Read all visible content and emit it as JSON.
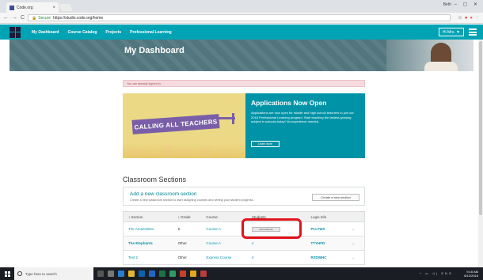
{
  "browser": {
    "tab_title": "Code.org",
    "tab_close": "×",
    "user_label": "Beth",
    "window_controls": "– ▢ ✕",
    "secure_label": "Secure",
    "url": "https://studio.code.org/home",
    "back": "←",
    "forward": "→",
    "reload": "C",
    "star": "☆"
  },
  "nav": {
    "items": [
      "My Dashboard",
      "Course Catalog",
      "Projects",
      "Professional Learning"
    ],
    "user_menu": "Hi Mrs. ▼"
  },
  "header": {
    "title": "My Dashboard"
  },
  "alert": {
    "text": "You are already signed in."
  },
  "promo": {
    "banner_text": "CALLING ALL TEACHERS",
    "heading": "Applications Now Open",
    "body": "Applications are now open for middle and high school teachers to join our 2018 Professional Learning program. Start teaching the fastest-growing subject in schools today! No experience needed.",
    "button": "Learn more"
  },
  "sections": {
    "title": "Classroom Sections",
    "add_heading": "Add a new classroom section",
    "add_desc": "Create a new classroom section to start assigning courses and seeing your student progress.",
    "create_button": "Create a new section",
    "columns": [
      "Section",
      "Grade",
      "Course",
      "Students",
      "Login Info"
    ],
    "rows": [
      {
        "section": "The Amazeletes",
        "grade": "K",
        "course": "Course A",
        "students_btn": "Add students",
        "login": "PLLTWX"
      },
      {
        "section": "The Elephants",
        "grade": "Other",
        "course": "Course A",
        "students": "4",
        "login": "TTYHFD"
      },
      {
        "section": "Test 2",
        "grade": "Other",
        "course": "Express Course",
        "students": "4",
        "login": "RZDWHC"
      }
    ]
  },
  "taskbar": {
    "search_placeholder": "Type here to search",
    "time": "9:16 AM",
    "date": "6/12/2018",
    "tray": "^ ▭ ◁) ENG"
  },
  "colors": {
    "teal": "#00a3b4",
    "promo_teal": "#0093a7",
    "highlight": "#e0141b",
    "banner_purple": "#7a5fa8"
  }
}
